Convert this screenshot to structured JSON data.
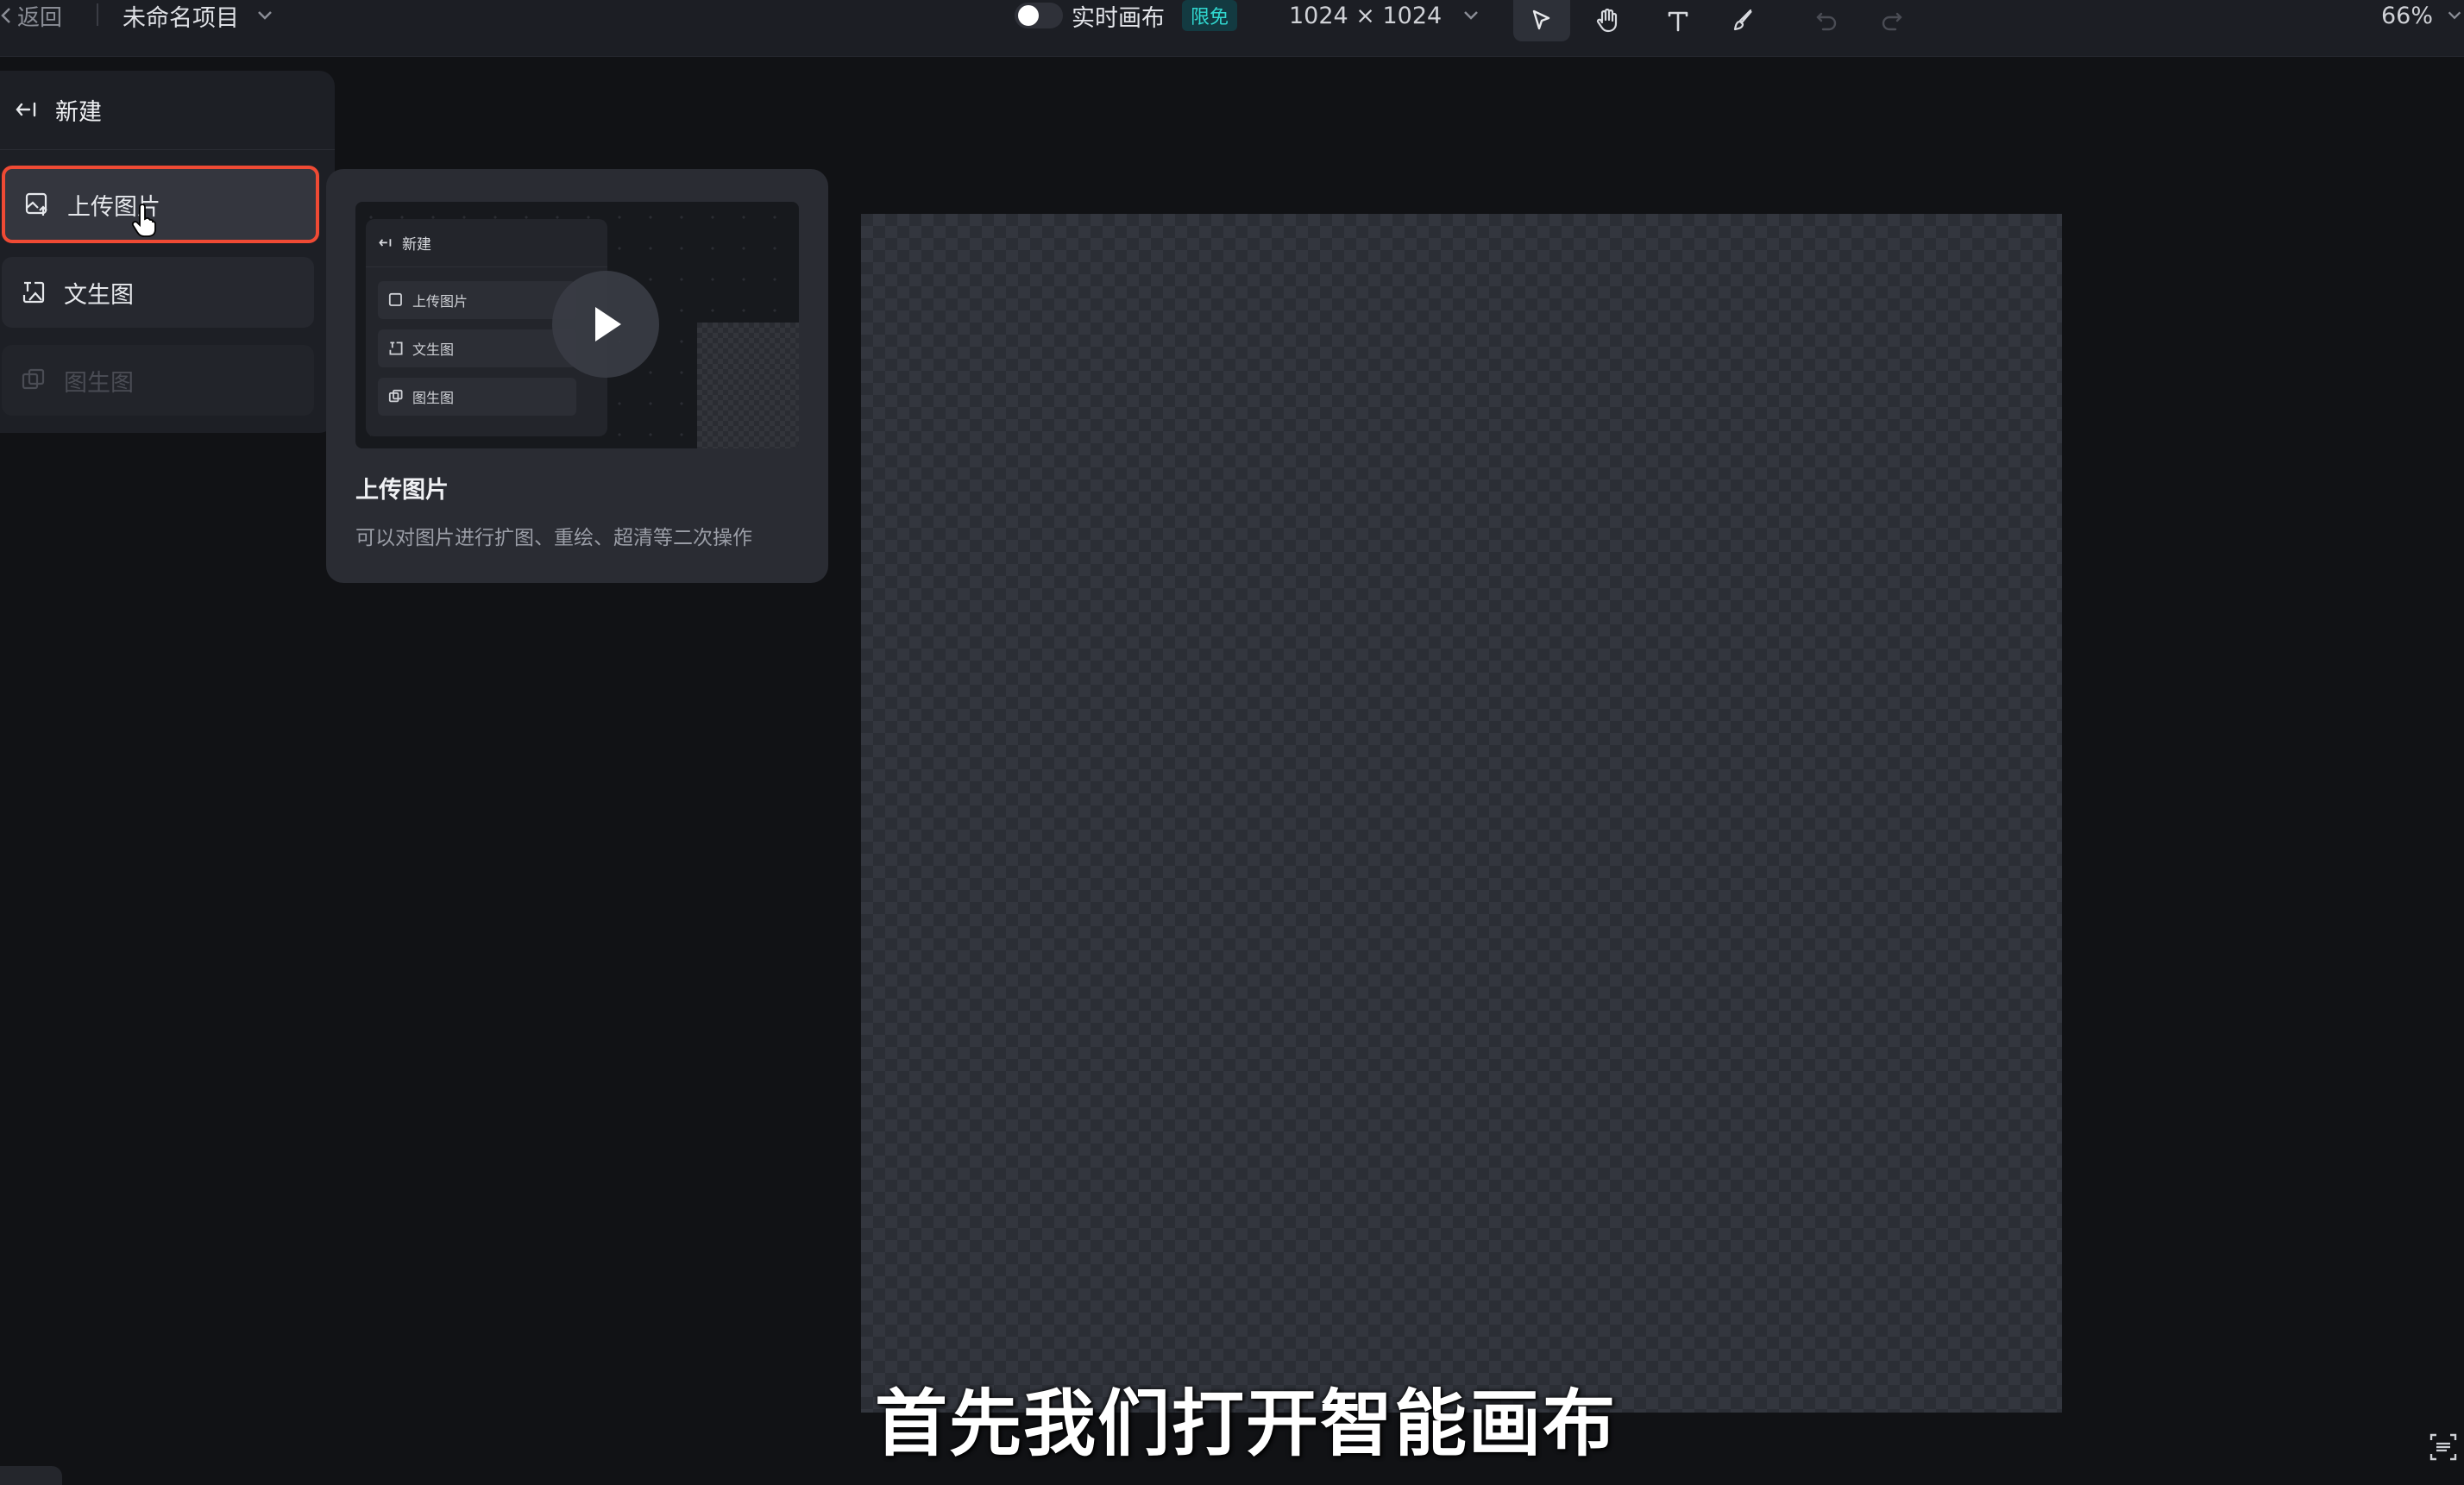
{
  "toolbar": {
    "back_label": "返回",
    "project_name": "未命名项目",
    "realtime_canvas_label": "实时画布",
    "free_badge": "限免",
    "canvas_size": "1024 × 1024",
    "zoom": "66%",
    "tools": [
      "select-icon",
      "hand-icon",
      "text-icon",
      "brush-icon",
      "undo-icon",
      "redo-icon"
    ]
  },
  "new_panel": {
    "title": "新建",
    "items": [
      {
        "label": "上传图片",
        "icon": "image-upload-icon",
        "state": "selected"
      },
      {
        "label": "文生图",
        "icon": "text-to-image-icon",
        "state": "normal"
      },
      {
        "label": "图生图",
        "icon": "image-to-image-icon",
        "state": "disabled"
      }
    ]
  },
  "preview": {
    "mini_title": "新建",
    "mini_items": [
      "上传图片",
      "文生图",
      "图生图"
    ],
    "title": "上传图片",
    "description": "可以对图片进行扩图、重绘、超清等二次操作"
  },
  "subtitle": "首先我们打开智能画布",
  "colors": {
    "selected_border": "#ef4a34",
    "badge_text": "#30d8d0",
    "background": "#111215"
  }
}
